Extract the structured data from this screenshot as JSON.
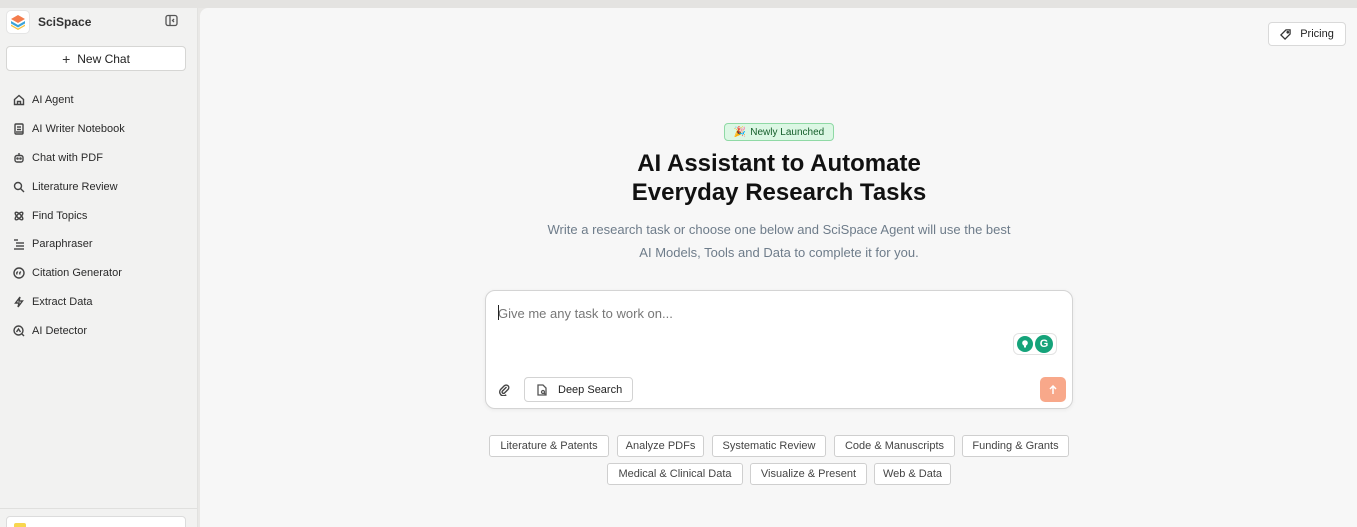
{
  "app": {
    "name": "SciSpace",
    "new_chat_label": "New Chat",
    "pricing_label": "Pricing"
  },
  "sidebar": {
    "items": [
      {
        "label": "AI Agent",
        "icon": "home-icon"
      },
      {
        "label": "AI Writer Notebook",
        "icon": "notebook-icon"
      },
      {
        "label": "Chat with PDF",
        "icon": "robot-icon"
      },
      {
        "label": "Literature Review",
        "icon": "search-icon"
      },
      {
        "label": "Find Topics",
        "icon": "atom-icon"
      },
      {
        "label": "Paraphraser",
        "icon": "lines-icon"
      },
      {
        "label": "Citation Generator",
        "icon": "quote-circle-icon"
      },
      {
        "label": "Extract Data",
        "icon": "bolt-icon"
      },
      {
        "label": "AI Detector",
        "icon": "detector-icon"
      }
    ]
  },
  "hero": {
    "badge": "Newly Launched",
    "badge_emoji": "🎉",
    "title_line1": "AI Assistant to Automate",
    "title_line2": "Everyday Research Tasks",
    "subtitle_line1": "Write a research task or choose one below and SciSpace Agent will use the best",
    "subtitle_line2": "AI Models, Tools and Data to complete it for you."
  },
  "taskbox": {
    "placeholder": "Give me any task to work on...",
    "value": "",
    "deep_search_label": "Deep Search",
    "extension_letter": "G"
  },
  "chips": {
    "row1": [
      "Literature & Patents",
      "Analyze PDFs",
      "Systematic Review",
      "Code & Manuscripts",
      "Funding & Grants"
    ],
    "row2": [
      "Medical & Clinical Data",
      "Visualize & Present",
      "Web & Data"
    ]
  },
  "colors": {
    "send_button": "#f8a88a",
    "badge_bg": "#dcf7e4",
    "badge_border": "#8fd9a5",
    "extension_green": "#15a37a"
  }
}
